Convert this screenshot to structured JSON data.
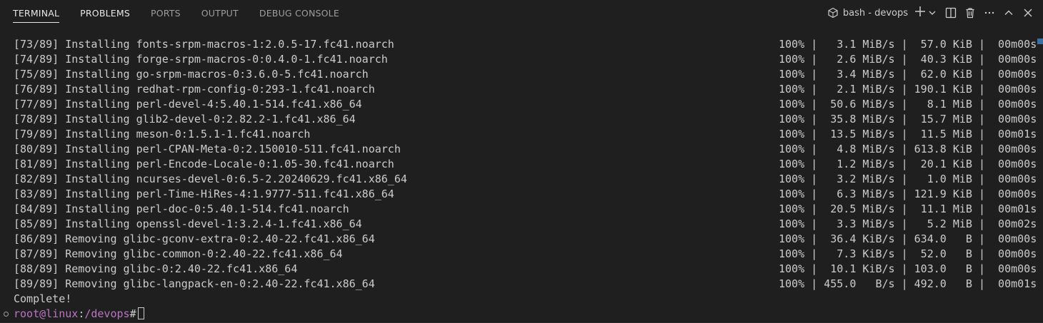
{
  "tabs": [
    {
      "label": "TERMINAL"
    },
    {
      "label": "PROBLEMS"
    },
    {
      "label": "PORTS"
    },
    {
      "label": "OUTPUT"
    },
    {
      "label": "DEBUG CONSOLE"
    }
  ],
  "terminal_selector": {
    "label": "bash - devops",
    "icon": "terminal-icon"
  },
  "actions": {
    "new": "plus-icon",
    "dropdown": "chevron-down-icon",
    "split": "split-icon",
    "kill": "trash-icon",
    "more": "ellipsis-icon",
    "maximize": "chevron-up-icon",
    "close": "close-icon"
  },
  "lines": [
    {
      "text": "[73/89] Installing fonts-srpm-macros-1:2.0.5-17.fc41.noarch",
      "stat": "100% |   3.1 MiB/s |  57.0 KiB |  00m00s"
    },
    {
      "text": "[74/89] Installing forge-srpm-macros-0:0.4.0-1.fc41.noarch",
      "stat": "100% |   2.6 MiB/s |  40.3 KiB |  00m00s"
    },
    {
      "text": "[75/89] Installing go-srpm-macros-0:3.6.0-5.fc41.noarch",
      "stat": "100% |   3.4 MiB/s |  62.0 KiB |  00m00s"
    },
    {
      "text": "[76/89] Installing redhat-rpm-config-0:293-1.fc41.noarch",
      "stat": "100% |   2.1 MiB/s | 190.1 KiB |  00m00s"
    },
    {
      "text": "[77/89] Installing perl-devel-4:5.40.1-514.fc41.x86_64",
      "stat": "100% |  50.6 MiB/s |   8.1 MiB |  00m00s"
    },
    {
      "text": "[78/89] Installing glib2-devel-0:2.82.2-1.fc41.x86_64",
      "stat": "100% |  35.8 MiB/s |  15.7 MiB |  00m00s"
    },
    {
      "text": "[79/89] Installing meson-0:1.5.1-1.fc41.noarch",
      "stat": "100% |  13.5 MiB/s |  11.5 MiB |  00m01s"
    },
    {
      "text": "[80/89] Installing perl-CPAN-Meta-0:2.150010-511.fc41.noarch",
      "stat": "100% |   4.8 MiB/s | 613.8 KiB |  00m00s"
    },
    {
      "text": "[81/89] Installing perl-Encode-Locale-0:1.05-30.fc41.noarch",
      "stat": "100% |   1.2 MiB/s |  20.1 KiB |  00m00s"
    },
    {
      "text": "[82/89] Installing ncurses-devel-0:6.5-2.20240629.fc41.x86_64",
      "stat": "100% |   3.2 MiB/s |   1.0 MiB |  00m00s"
    },
    {
      "text": "[83/89] Installing perl-Time-HiRes-4:1.9777-511.fc41.x86_64",
      "stat": "100% |   6.3 MiB/s | 121.9 KiB |  00m00s"
    },
    {
      "text": "[84/89] Installing perl-doc-0:5.40.1-514.fc41.noarch",
      "stat": "100% |  20.5 MiB/s |  11.1 MiB |  00m01s"
    },
    {
      "text": "[85/89] Installing openssl-devel-1:3.2.4-1.fc41.x86_64",
      "stat": "100% |   3.3 MiB/s |   5.2 MiB |  00m02s"
    },
    {
      "text": "[86/89] Removing glibc-gconv-extra-0:2.40-22.fc41.x86_64",
      "stat": "100% |  36.4 KiB/s | 634.0   B |  00m00s"
    },
    {
      "text": "[87/89] Removing glibc-common-0:2.40-22.fc41.x86_64",
      "stat": "100% |   7.3 KiB/s |  52.0   B |  00m00s"
    },
    {
      "text": "[88/89] Removing glibc-0:2.40-22.fc41.x86_64",
      "stat": "100% |  10.1 KiB/s | 103.0   B |  00m00s"
    },
    {
      "text": "[89/89] Removing glibc-langpack-en-0:2.40-22.fc41.x86_64",
      "stat": "100% | 455.0   B/s | 492.0   B |  00m01s"
    }
  ],
  "complete_text": "Complete!",
  "prompt": {
    "user": "root@linux",
    "sep": ":",
    "path": "/devops",
    "symbol": "#"
  },
  "colors": {
    "background": "#1f1f1f",
    "text": "#cccccc",
    "prompt": "#bc74c4",
    "accent": "#3b6fa0"
  }
}
